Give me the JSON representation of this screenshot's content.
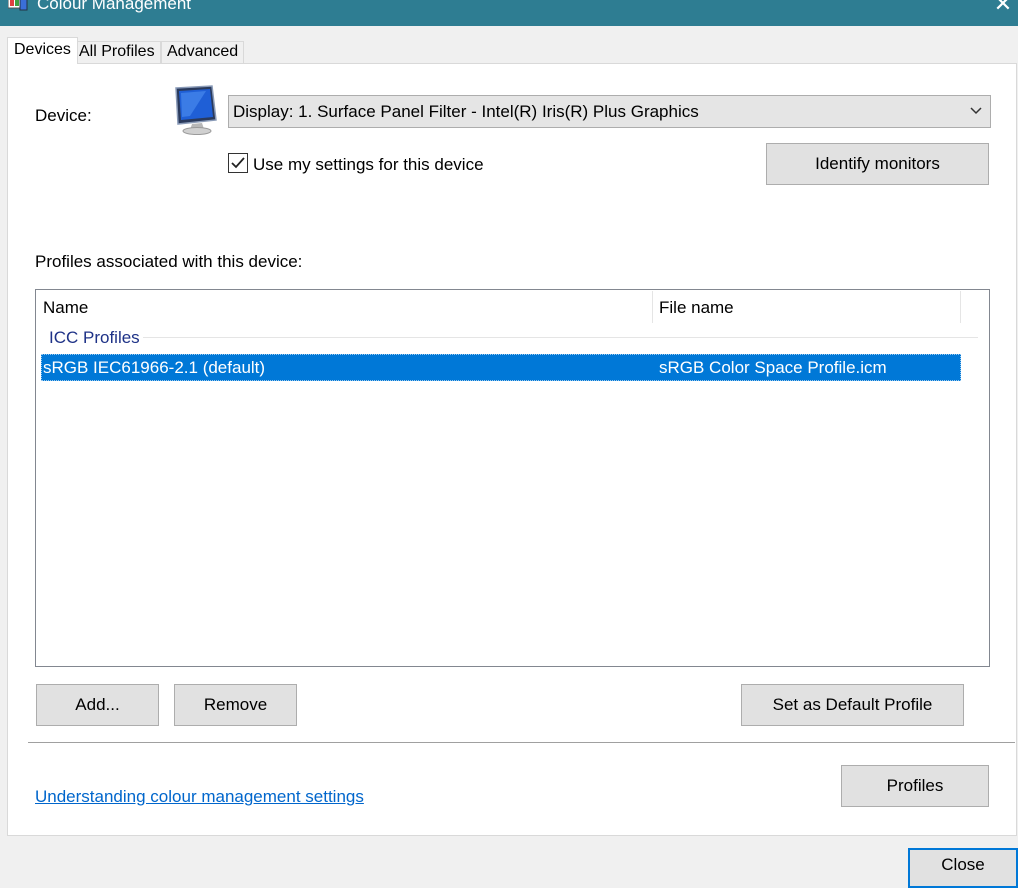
{
  "window": {
    "title": "Colour Management"
  },
  "tabs": [
    {
      "label": "Devices",
      "active": true
    },
    {
      "label": "All Profiles",
      "active": false
    },
    {
      "label": "Advanced",
      "active": false
    }
  ],
  "device": {
    "label": "Device:",
    "selected": "Display: 1. Surface Panel Filter - Intel(R) Iris(R) Plus Graphics",
    "icon": "monitor-icon"
  },
  "use_settings": {
    "label": "Use my settings for this device",
    "checked": true
  },
  "buttons": {
    "identify": "Identify monitors",
    "add": "Add...",
    "remove": "Remove",
    "set_default": "Set as Default Profile",
    "profiles": "Profiles",
    "close": "Close"
  },
  "profiles_label": "Profiles associated with this device:",
  "list": {
    "columns": [
      "Name",
      "File name"
    ],
    "group": "ICC Profiles",
    "rows": [
      {
        "name": "sRGB IEC61966-2.1 (default)",
        "file": "sRGB Color Space Profile.icm",
        "selected": true
      }
    ]
  },
  "help_link": "Understanding colour management settings",
  "colors": {
    "titlebar": "#2e7d92",
    "selection": "#0078d7",
    "link": "#0066cc"
  }
}
